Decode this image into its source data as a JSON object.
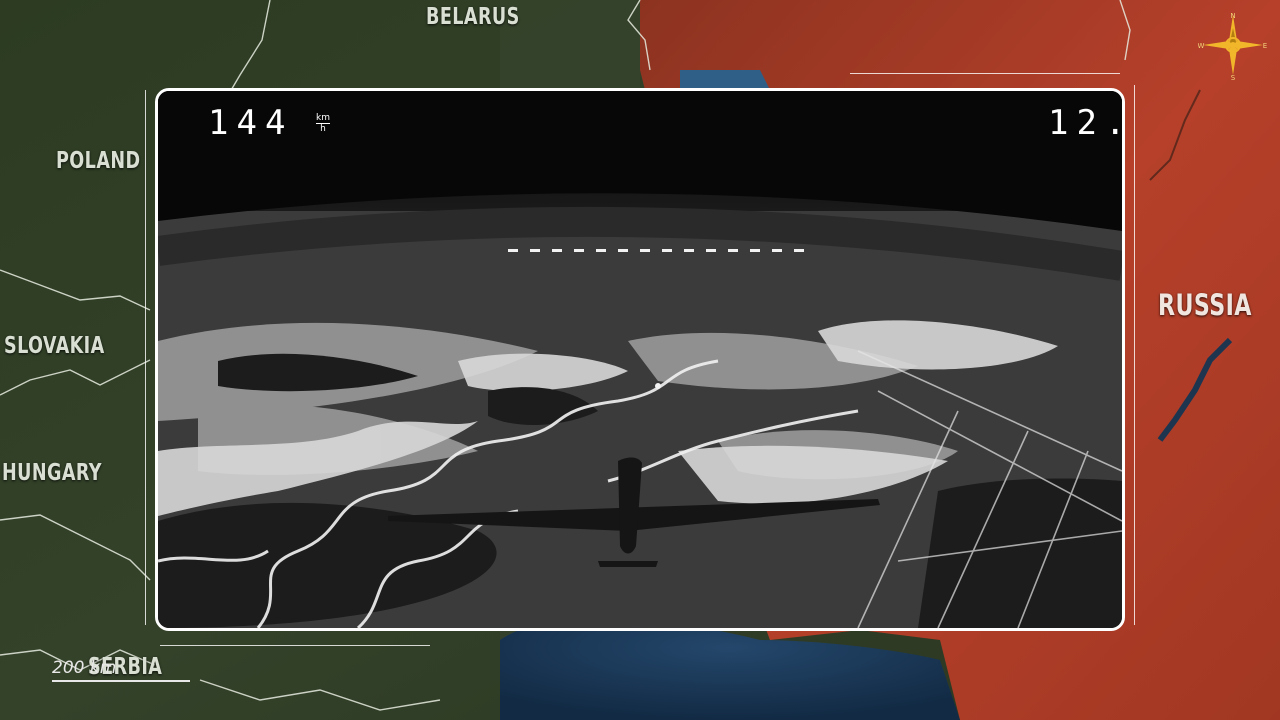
{
  "map": {
    "countries": {
      "belarus": "BELARUS",
      "poland": "POLAND",
      "slovakia": "SLOVAKIA",
      "hungary": "HUNGARY",
      "serbia": "SERBIA",
      "russia": "RUSSIA"
    },
    "scale_label": "200 km",
    "compass": {
      "n": "N",
      "s": "S",
      "e": "E",
      "w": "W"
    },
    "colors": {
      "land": "#2f3d24",
      "russia_highlight": "#b3371f",
      "sea": "#1c3b5c",
      "border": "#e8ece0"
    }
  },
  "video": {
    "speed_value": "144",
    "speed_unit_top": "km",
    "speed_unit_bottom": "h",
    "altitude_value": "12.",
    "frame_color": "#ffffff"
  }
}
